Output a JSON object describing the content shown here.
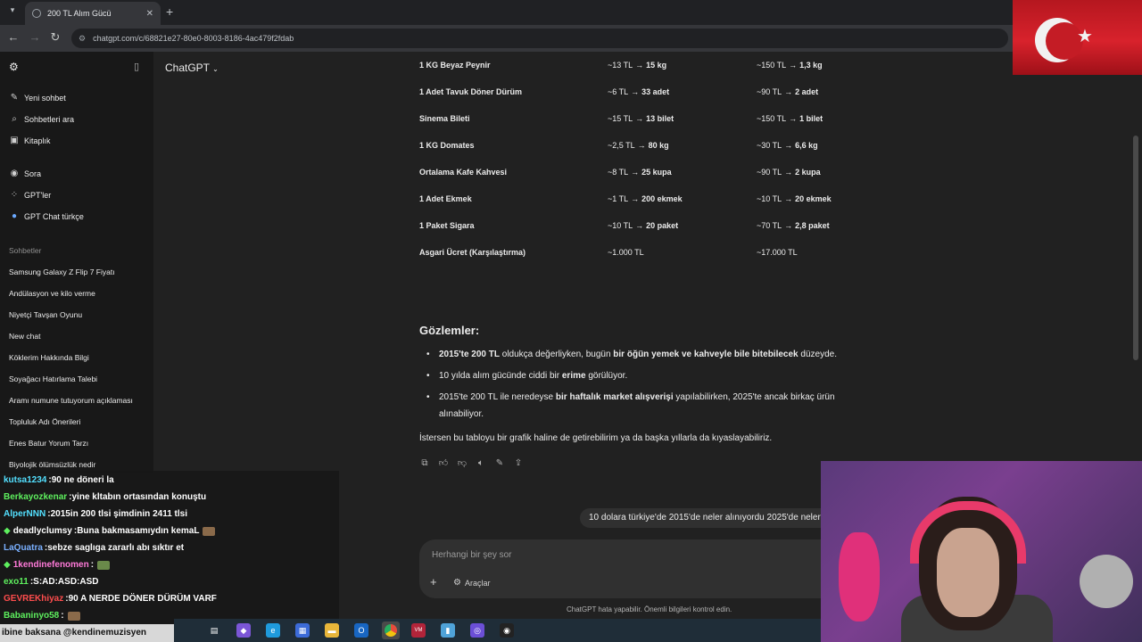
{
  "browser": {
    "tab_title": "200 TL Alım Gücü",
    "url": "chatgpt.com/c/68821e27-80e0-8003-8186-4ac479f2fdab"
  },
  "sidebar": {
    "items": [
      {
        "label": "Yeni sohbet",
        "icon": "edit-icon"
      },
      {
        "label": "Sohbetleri ara",
        "icon": "search-icon"
      },
      {
        "label": "Kitaplık",
        "icon": "library-icon"
      },
      {
        "label": "Sora",
        "icon": "sora-icon"
      },
      {
        "label": "GPT'ler",
        "icon": "grid-icon"
      },
      {
        "label": "GPT Chat türkçe",
        "icon": "gpt-avatar-icon"
      }
    ],
    "chats_heading": "Sohbetler",
    "chats": [
      "Samsung Galaxy Z Flip 7 Fiyatı",
      "Andülasyon ve kilo verme",
      "Niyetçi Tavşan Oyunu",
      "New chat",
      "Köklerim Hakkında Bilgi",
      "Soyağacı Hatırlama Talebi",
      "Aramı numune tutuyorum açıklaması",
      "Topluluk Adı Önerileri",
      "Enes Batur Yorum Tarzı",
      "Biyolojik ölümsüzlük nedir"
    ]
  },
  "header": {
    "model": "ChatGPT"
  },
  "table": {
    "rows": [
      {
        "item": "1 KG Beyaz Peynir",
        "p2015": "~13 TL",
        "q2015": "15 kg",
        "p2025": "~150 TL",
        "q2025": "1,3 kg"
      },
      {
        "item": "1 Adet Tavuk Döner Dürüm",
        "p2015": "~6 TL",
        "q2015": "33 adet",
        "p2025": "~90 TL",
        "q2025": "2 adet"
      },
      {
        "item": "Sinema Bileti",
        "p2015": "~15 TL",
        "q2015": "13 bilet",
        "p2025": "~150 TL",
        "q2025": "1 bilet"
      },
      {
        "item": "1 KG Domates",
        "p2015": "~2,5 TL",
        "q2015": "80 kg",
        "p2025": "~30 TL",
        "q2025": "6,6 kg"
      },
      {
        "item": "Ortalama Kafe Kahvesi",
        "p2015": "~8 TL",
        "q2015": "25 kupa",
        "p2025": "~90 TL",
        "q2025": "2 kupa"
      },
      {
        "item": "1 Adet Ekmek",
        "p2015": "~1 TL",
        "q2015": "200 ekmek",
        "p2025": "~10 TL",
        "q2025": "20 ekmek"
      },
      {
        "item": "1 Paket Sigara",
        "p2015": "~10 TL",
        "q2015": "20 paket",
        "p2025": "~70 TL",
        "q2025": "2,8 paket"
      },
      {
        "item": "Asgari Ücret (Karşılaştırma)",
        "p2015": "~1.000 TL",
        "q2015": "",
        "p2025": "~17.000 TL",
        "q2025": ""
      }
    ],
    "arrow": "→"
  },
  "observations": {
    "title": "Gözlemler:",
    "b1_a": "2015'te 200 TL",
    "b1_b": " oldukça değerliyken, bugün ",
    "b1_c": "bir öğün yemek ve kahveyle bile bitebilecek",
    "b1_d": " düzeyde.",
    "b2_a": "10 yılda alım gücünde ciddi bir ",
    "b2_b": "erime",
    "b2_c": " görülüyor.",
    "b3_a": "2015'te 200 TL ile neredeyse ",
    "b3_b": "bir haftalık market alışverişi",
    "b3_c": " yapılabilirken, 2025'te ancak birkaç ürün alınabiliyor.",
    "closing": "İstersen bu tabloyu bir grafik haline de getirebilirim ya da başka yıllarla da kıyaslayabiliriz."
  },
  "user_message": "10 dolara türkiye'de 2015'de neler alınıyordu 2025'de neler",
  "composer": {
    "placeholder": "Herhangi bir şey sor",
    "tools_label": "Araçlar"
  },
  "disclaimer": "ChatGPT hata yapabilir. Önemli bilgileri kontrol edin.",
  "stream_chat": [
    {
      "user": "kutsa1234",
      "text": "90 ne döneri la",
      "color": "#53e0ff",
      "badge": false
    },
    {
      "user": "Berkayozkenar",
      "text": "yine kltabın ortasından konuştu",
      "color": "#5ef05e",
      "badge": false
    },
    {
      "user": "AlperNNN",
      "text": "2015in 200 tlsi şimdinin 2411 tlsi",
      "color": "#53e0ff",
      "badge": false
    },
    {
      "user": "deadlyclumsy",
      "text": "Buna bakmasamıydın kemaL",
      "color": "#ffffff",
      "badge": true
    },
    {
      "user": "LaQuatra",
      "text": "sebze saglıga zararlı abı sıktır et",
      "color": "#7ab0ff",
      "badge": false
    },
    {
      "user": "1kendinefenomen",
      "text": "",
      "color": "#ff7ad9",
      "badge": true
    },
    {
      "user": "exo11",
      "text": "S:AD:ASD:ASD",
      "color": "#5ef05e",
      "badge": false
    },
    {
      "user": "GEVREKhiyaz",
      "text": "90 A NERDE DÖNER DÜRÜM VARF",
      "color": "#ff4d4d",
      "badge": false
    },
    {
      "user": "Babaninyo58",
      "text": "",
      "color": "#5ef05e",
      "badge": false
    }
  ],
  "ticker": "ibine baksana @kendinemuzisyen"
}
